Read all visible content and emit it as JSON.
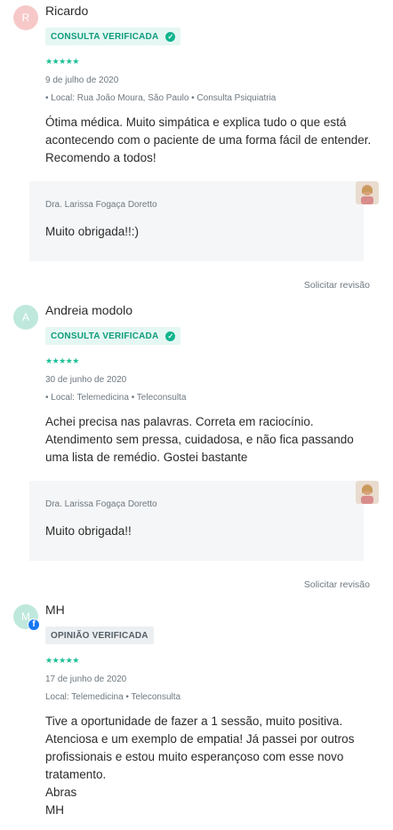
{
  "reviews": [
    {
      "initial": "R",
      "name": "Ricardo",
      "badge": "CONSULTA VERIFICADA",
      "stars": "★★★★★",
      "date": "9 de julho de 2020",
      "location": "• Local: Rua João Moura, São Paulo • Consulta Psiquiatria",
      "text": "Ótima médica. Muito simpática e explica tudo o que está acontecendo com o paciente de uma forma fácil de entender. Recomendo a todos!",
      "reply_doctor": "Dra. Larissa Fogaça Doretto",
      "reply_text": "Muito obrigada!!:)",
      "action": "Solicitar revisão"
    },
    {
      "initial": "A",
      "name": "Andreia modolo",
      "badge": "CONSULTA VERIFICADA",
      "stars": "★★★★★",
      "date": "30 de junho de 2020",
      "location": "• Local: Telemedicina • Teleconsulta",
      "text": "Achei precisa nas palavras. Correta em raciocínio. Atendimento sem pressa, cuidadosa, e não fica passando uma lista de remédio. Gostei bastante",
      "reply_doctor": "Dra. Larissa Fogaça Doretto",
      "reply_text": "Muito obrigada!!",
      "action": "Solicitar revisão"
    },
    {
      "initial": "M",
      "name": "MH",
      "badge": "OPINIÃO VERIFICADA",
      "stars": "★★★★★",
      "date": "17 de junho de 2020",
      "location": "Local: Telemedicina • Teleconsulta",
      "text_lines": [
        "Tive a oportunidade de fazer a 1 sessão, muito positiva.",
        "Atenciosa e um exemplo de empatia! Já passei por outros",
        "profissionais e estou muito esperançoso com esse novo",
        "tratamento.",
        "Abras",
        "MH"
      ]
    }
  ],
  "colors": {
    "avatar_r": "#f7c8c8",
    "avatar_a": "#bfe8dc",
    "avatar_m": "#bfe8dc",
    "verified_green": "#0f9c7c",
    "stars": "#1bbf96",
    "facebook": "#1877f2"
  },
  "icons": [
    "check-circle-icon",
    "star-icon",
    "facebook-icon",
    "doctor-photo"
  ]
}
